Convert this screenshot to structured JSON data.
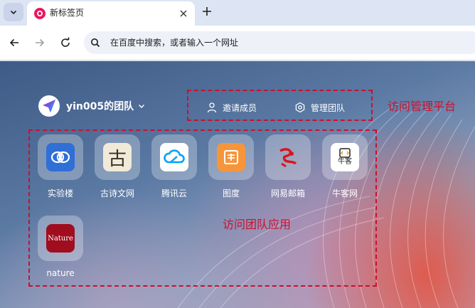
{
  "browser": {
    "tab": {
      "title": "新标签页",
      "favicon": "browser-logo-icon"
    },
    "new_tab_icon": "plus-icon",
    "omnibox": {
      "placeholder": "在百度中搜索，或者输入一个网址",
      "search_icon": "search-icon"
    }
  },
  "team": {
    "name": "yin005的团队",
    "avatar_icon": "paper-plane-logo-icon",
    "actions": [
      {
        "label": "邀请成员",
        "icon": "user-icon"
      },
      {
        "label": "管理团队",
        "icon": "hexagon-settings-icon"
      }
    ]
  },
  "apps": [
    {
      "label": "实验楼",
      "icon": "shiyanlou-icon",
      "color": "#2f6fd6"
    },
    {
      "label": "古诗文网",
      "icon": "gushiwen-icon",
      "icon_text": "古",
      "color": "#f1ead8"
    },
    {
      "label": "腾讯云",
      "icon": "tencent-cloud-icon",
      "color": "#00a3ff"
    },
    {
      "label": "图度",
      "icon": "tudu-icon",
      "color": "#f7953b"
    },
    {
      "label": "网易邮箱",
      "icon": "netease-mail-icon",
      "color": "#d7161e"
    },
    {
      "label": "牛客网",
      "icon": "nowcoder-icon",
      "icon_text": "牛客",
      "color": "#ffffff"
    },
    {
      "label": "nature",
      "icon": "nature-icon",
      "icon_text": "Nature",
      "color": "#a00d1f"
    }
  ],
  "annotations": {
    "manage": "访问管理平台",
    "apps": "访问团队应用",
    "color": "#cc0f2e"
  }
}
